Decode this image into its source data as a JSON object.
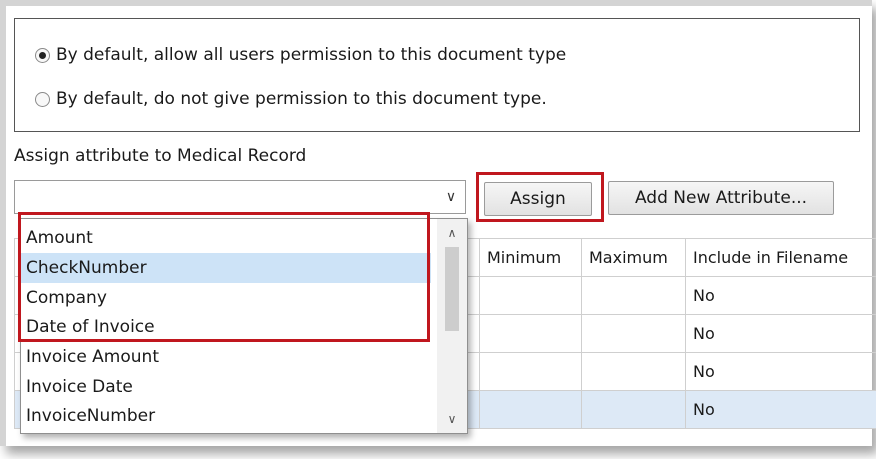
{
  "permissions": {
    "options": [
      {
        "label": "By default, allow all users permission to this document type",
        "checked": true
      },
      {
        "label": "By default, do not give permission to this document type.",
        "checked": false
      }
    ]
  },
  "assign_section": {
    "label": "Assign attribute to Medical Record",
    "combo_value": "",
    "assign_button": "Assign",
    "add_button": "Add New Attribute..."
  },
  "dropdown": {
    "items": [
      "Amount",
      "CheckNumber",
      "Company",
      "Date of Invoice",
      "Invoice Amount",
      "Invoice Date",
      "InvoiceNumber"
    ],
    "hovered": "CheckNumber"
  },
  "grid": {
    "headers": [
      "",
      "",
      "Minimum",
      "Maximum",
      "Include in Filename"
    ],
    "rows": [
      [
        "",
        "",
        "",
        "",
        "No"
      ],
      [
        "",
        "",
        "",
        "",
        "No"
      ],
      [
        "",
        "",
        "",
        "",
        "No"
      ],
      [
        "",
        "",
        "",
        "",
        "No"
      ]
    ],
    "selected_row": 3
  },
  "colors": {
    "highlight_border": "#c0171e",
    "hover_item": "#cde3f7",
    "selected_row": "#dde9f6"
  }
}
